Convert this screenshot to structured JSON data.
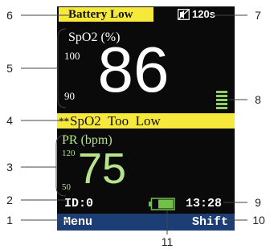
{
  "status_bar": {
    "alarm_title": "Battery Low",
    "mute_icon": "alarm-mute-icon",
    "mute_time": "120s"
  },
  "spo2": {
    "label": "SpO2 (%)",
    "high_limit": "100",
    "low_limit": "90",
    "value": "86",
    "pulse_bar_icon": "pulse-strength-bar-icon"
  },
  "alarm_message": {
    "priority": "**",
    "text": "SpO2  Too  Low"
  },
  "pr": {
    "label": "PR (bpm)",
    "high_limit": "120",
    "low_limit": "50",
    "value": "75"
  },
  "info_row": {
    "patient_id": "ID:0",
    "battery_icon": "battery-icon",
    "time": "13:28"
  },
  "softkeys": {
    "left": "Menu",
    "right": "Shift"
  },
  "callouts": [
    "1",
    "2",
    "3",
    "4",
    "5",
    "6",
    "7",
    "8",
    "9",
    "10",
    "11"
  ],
  "colors": {
    "screen_bg": "#0a0a0a",
    "alarm_yellow": "#f7e93b",
    "pr_green": "#b6e48a",
    "softkey_blue": "#1d3e74",
    "battery_green": "#72c04a"
  }
}
